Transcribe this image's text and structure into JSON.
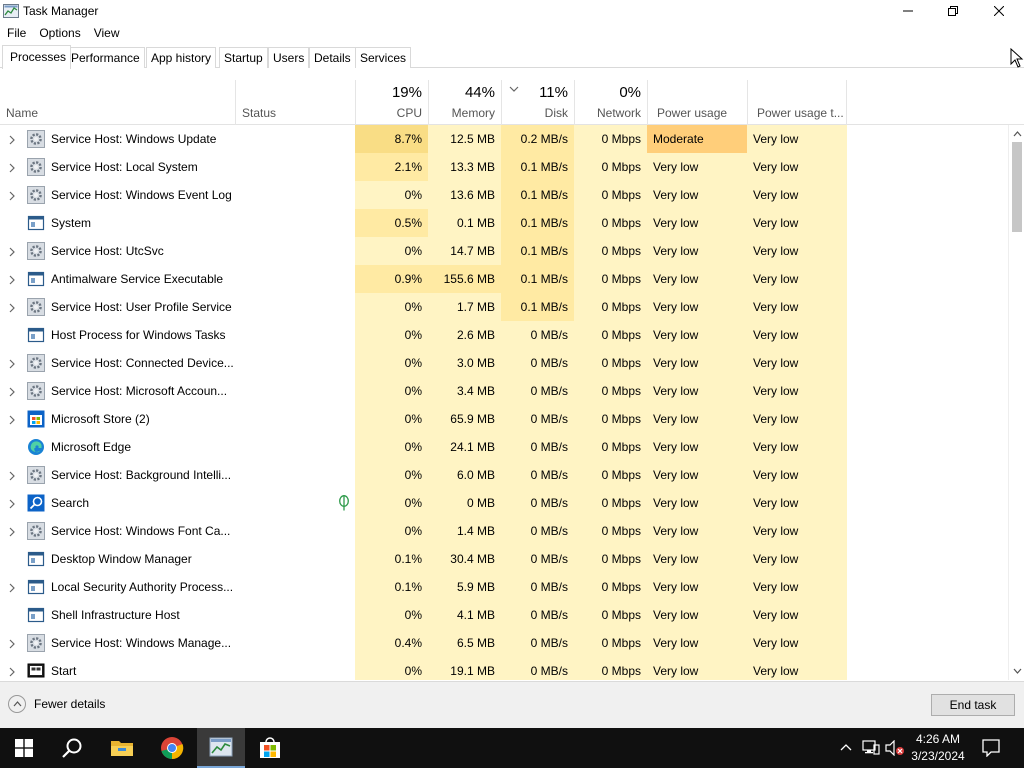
{
  "window": {
    "title": "Task Manager",
    "minimize_label": "—",
    "maximize_label": "□",
    "close_label": "✕"
  },
  "menu": [
    "File",
    "Options",
    "View"
  ],
  "tabs": [
    {
      "label": "Processes",
      "active": true
    },
    {
      "label": "Performance"
    },
    {
      "label": "App history"
    },
    {
      "label": "Startup"
    },
    {
      "label": "Users"
    },
    {
      "label": "Details"
    },
    {
      "label": "Services"
    }
  ],
  "columns": {
    "name": "Name",
    "status": "Status",
    "cpu": {
      "pct": "19%",
      "label": "CPU"
    },
    "memory": {
      "pct": "44%",
      "label": "Memory"
    },
    "disk": {
      "pct": "11%",
      "label": "Disk"
    },
    "network": {
      "pct": "0%",
      "label": "Network"
    },
    "power": "Power usage",
    "power_trend": "Power usage t..."
  },
  "processes": [
    {
      "name": "Service Host: Windows Update",
      "icon": "gear-icon",
      "expandable": true,
      "cpu": "8.7%",
      "memory": "12.5 MB",
      "disk": "0.2 MB/s",
      "network": "0 Mbps",
      "power": "Moderate",
      "power_trend": "Very low"
    },
    {
      "name": "Service Host: Local System",
      "icon": "gear-icon",
      "expandable": true,
      "cpu": "2.1%",
      "memory": "13.3 MB",
      "disk": "0.1 MB/s",
      "network": "0 Mbps",
      "power": "Very low",
      "power_trend": "Very low"
    },
    {
      "name": "Service Host: Windows Event Log",
      "icon": "gear-icon",
      "expandable": true,
      "cpu": "0%",
      "memory": "13.6 MB",
      "disk": "0.1 MB/s",
      "network": "0 Mbps",
      "power": "Very low",
      "power_trend": "Very low"
    },
    {
      "name": "System",
      "icon": "window-icon",
      "expandable": false,
      "cpu": "0.5%",
      "memory": "0.1 MB",
      "disk": "0.1 MB/s",
      "network": "0 Mbps",
      "power": "Very low",
      "power_trend": "Very low"
    },
    {
      "name": "Service Host: UtcSvc",
      "icon": "gear-icon",
      "expandable": true,
      "cpu": "0%",
      "memory": "14.7 MB",
      "disk": "0.1 MB/s",
      "network": "0 Mbps",
      "power": "Very low",
      "power_trend": "Very low"
    },
    {
      "name": "Antimalware Service Executable",
      "icon": "window-icon",
      "expandable": true,
      "cpu": "0.9%",
      "memory": "155.6 MB",
      "disk": "0.1 MB/s",
      "network": "0 Mbps",
      "power": "Very low",
      "power_trend": "Very low"
    },
    {
      "name": "Service Host: User Profile Service",
      "icon": "gear-icon",
      "expandable": true,
      "cpu": "0%",
      "memory": "1.7 MB",
      "disk": "0.1 MB/s",
      "network": "0 Mbps",
      "power": "Very low",
      "power_trend": "Very low"
    },
    {
      "name": "Host Process for Windows Tasks",
      "icon": "window-icon",
      "expandable": false,
      "cpu": "0%",
      "memory": "2.6 MB",
      "disk": "0 MB/s",
      "network": "0 Mbps",
      "power": "Very low",
      "power_trend": "Very low"
    },
    {
      "name": "Service Host: Connected Device...",
      "icon": "gear-icon",
      "expandable": true,
      "cpu": "0%",
      "memory": "3.0 MB",
      "disk": "0 MB/s",
      "network": "0 Mbps",
      "power": "Very low",
      "power_trend": "Very low"
    },
    {
      "name": "Service Host: Microsoft Accoun...",
      "icon": "gear-icon",
      "expandable": true,
      "cpu": "0%",
      "memory": "3.4 MB",
      "disk": "0 MB/s",
      "network": "0 Mbps",
      "power": "Very low",
      "power_trend": "Very low"
    },
    {
      "name": "Microsoft Store (2)",
      "icon": "store-icon",
      "expandable": true,
      "cpu": "0%",
      "memory": "65.9 MB",
      "disk": "0 MB/s",
      "network": "0 Mbps",
      "power": "Very low",
      "power_trend": "Very low"
    },
    {
      "name": "Microsoft Edge",
      "icon": "edge-icon",
      "expandable": false,
      "cpu": "0%",
      "memory": "24.1 MB",
      "disk": "0 MB/s",
      "network": "0 Mbps",
      "power": "Very low",
      "power_trend": "Very low"
    },
    {
      "name": "Service Host: Background Intelli...",
      "icon": "gear-icon",
      "expandable": true,
      "cpu": "0%",
      "memory": "6.0 MB",
      "disk": "0 MB/s",
      "network": "0 Mbps",
      "power": "Very low",
      "power_trend": "Very low"
    },
    {
      "name": "Search",
      "icon": "search-icon",
      "expandable": true,
      "status_icon": "leaf-icon",
      "cpu": "0%",
      "memory": "0 MB",
      "disk": "0 MB/s",
      "network": "0 Mbps",
      "power": "Very low",
      "power_trend": "Very low"
    },
    {
      "name": "Service Host: Windows Font Ca...",
      "icon": "gear-icon",
      "expandable": true,
      "cpu": "0%",
      "memory": "1.4 MB",
      "disk": "0 MB/s",
      "network": "0 Mbps",
      "power": "Very low",
      "power_trend": "Very low"
    },
    {
      "name": "Desktop Window Manager",
      "icon": "window-icon",
      "expandable": false,
      "cpu": "0.1%",
      "memory": "30.4 MB",
      "disk": "0 MB/s",
      "network": "0 Mbps",
      "power": "Very low",
      "power_trend": "Very low"
    },
    {
      "name": "Local Security Authority Process...",
      "icon": "window-icon",
      "expandable": true,
      "cpu": "0.1%",
      "memory": "5.9 MB",
      "disk": "0 MB/s",
      "network": "0 Mbps",
      "power": "Very low",
      "power_trend": "Very low"
    },
    {
      "name": "Shell Infrastructure Host",
      "icon": "window-icon",
      "expandable": false,
      "cpu": "0%",
      "memory": "4.1 MB",
      "disk": "0 MB/s",
      "network": "0 Mbps",
      "power": "Very low",
      "power_trend": "Very low"
    },
    {
      "name": "Service Host: Windows Manage...",
      "icon": "gear-icon",
      "expandable": true,
      "cpu": "0.4%",
      "memory": "6.5 MB",
      "disk": "0 MB/s",
      "network": "0 Mbps",
      "power": "Very low",
      "power_trend": "Very low"
    },
    {
      "name": "Start",
      "icon": "monitor-icon",
      "expandable": true,
      "cpu": "0%",
      "memory": "19.1 MB",
      "disk": "0 MB/s",
      "network": "0 Mbps",
      "power": "Very low",
      "power_trend": "Very low"
    }
  ],
  "footer": {
    "fewer_details": "Fewer details",
    "end_task": "End task"
  },
  "taskbar": {
    "items": [
      "start-icon",
      "search-icon",
      "file-explorer-icon",
      "chrome-icon",
      "task-manager-icon",
      "store-icon"
    ],
    "time": "4:26 AM",
    "date": "3/23/2024"
  },
  "colors": {
    "heat_light": "#fff4c4",
    "heat_mid": "#ffeaa3",
    "heat_strong": "#f9dd85",
    "heat_moderate": "#ffce7a",
    "taskbar": "#101010"
  }
}
